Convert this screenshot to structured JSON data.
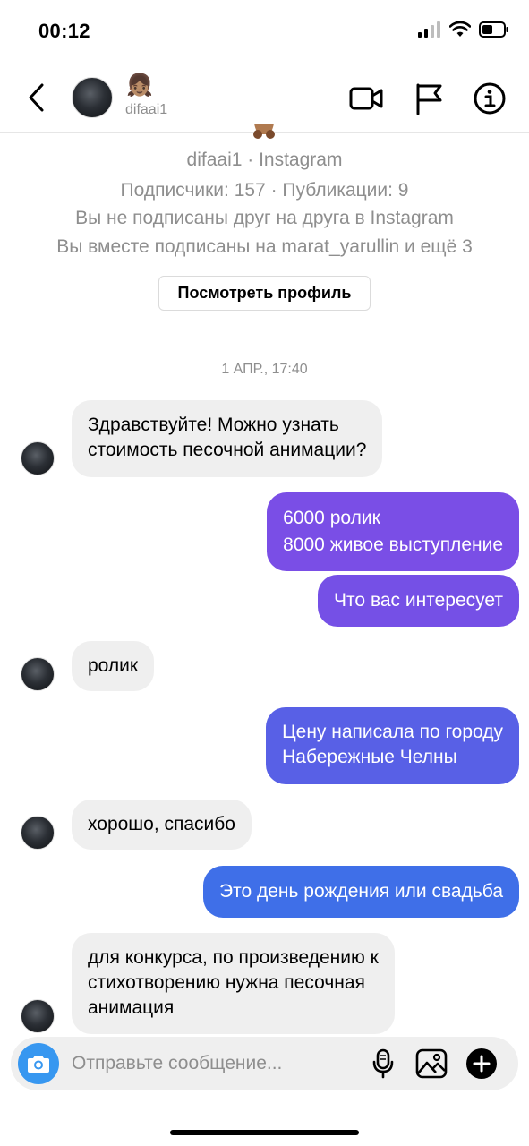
{
  "status_bar": {
    "time": "00:12"
  },
  "header": {
    "emoji": "👧🏽",
    "username": "difaai1",
    "icons": [
      "chevron-left-icon",
      "video-camera-icon",
      "flag-icon",
      "info-icon"
    ]
  },
  "profile": {
    "line1": "difaai1 · Instagram",
    "line2": "Подписчики: 157 · Публикации: 9",
    "line3": "Вы не подписаны друг на друга в Instagram",
    "line4": "Вы вместе подписаны на marat_yarullin и ещё 3",
    "view_profile_label": "Посмотреть профиль"
  },
  "timestamp": "1 АПР., 17:40",
  "messages": [
    {
      "dir": "in",
      "text": "Здравствуйте! Можно узнать\nстоимость песочной анимации?"
    },
    {
      "dir": "out",
      "text": "6000 ролик\n8000 живое выступление",
      "color": "#7a4ee6"
    },
    {
      "dir": "out",
      "text": "Что вас интересует",
      "color": "#7550e6"
    },
    {
      "dir": "in",
      "text": "ролик"
    },
    {
      "dir": "out",
      "text": "Цену написала по городу\nНабережные Челны",
      "color": "#5860e6"
    },
    {
      "dir": "in",
      "text": "хорошо, спасибо"
    },
    {
      "dir": "out",
      "text": "Это день рождения или свадьба",
      "color": "#3f6fe8"
    },
    {
      "dir": "in",
      "text": "для конкурса, по произведению к\nстихотворению нужна песочная\nанимация"
    }
  ],
  "composer": {
    "placeholder": "Отправьте сообщение...",
    "icons": [
      "camera-icon",
      "microphone-icon",
      "image-icon",
      "plus-icon"
    ],
    "accent": "#3797f0"
  }
}
